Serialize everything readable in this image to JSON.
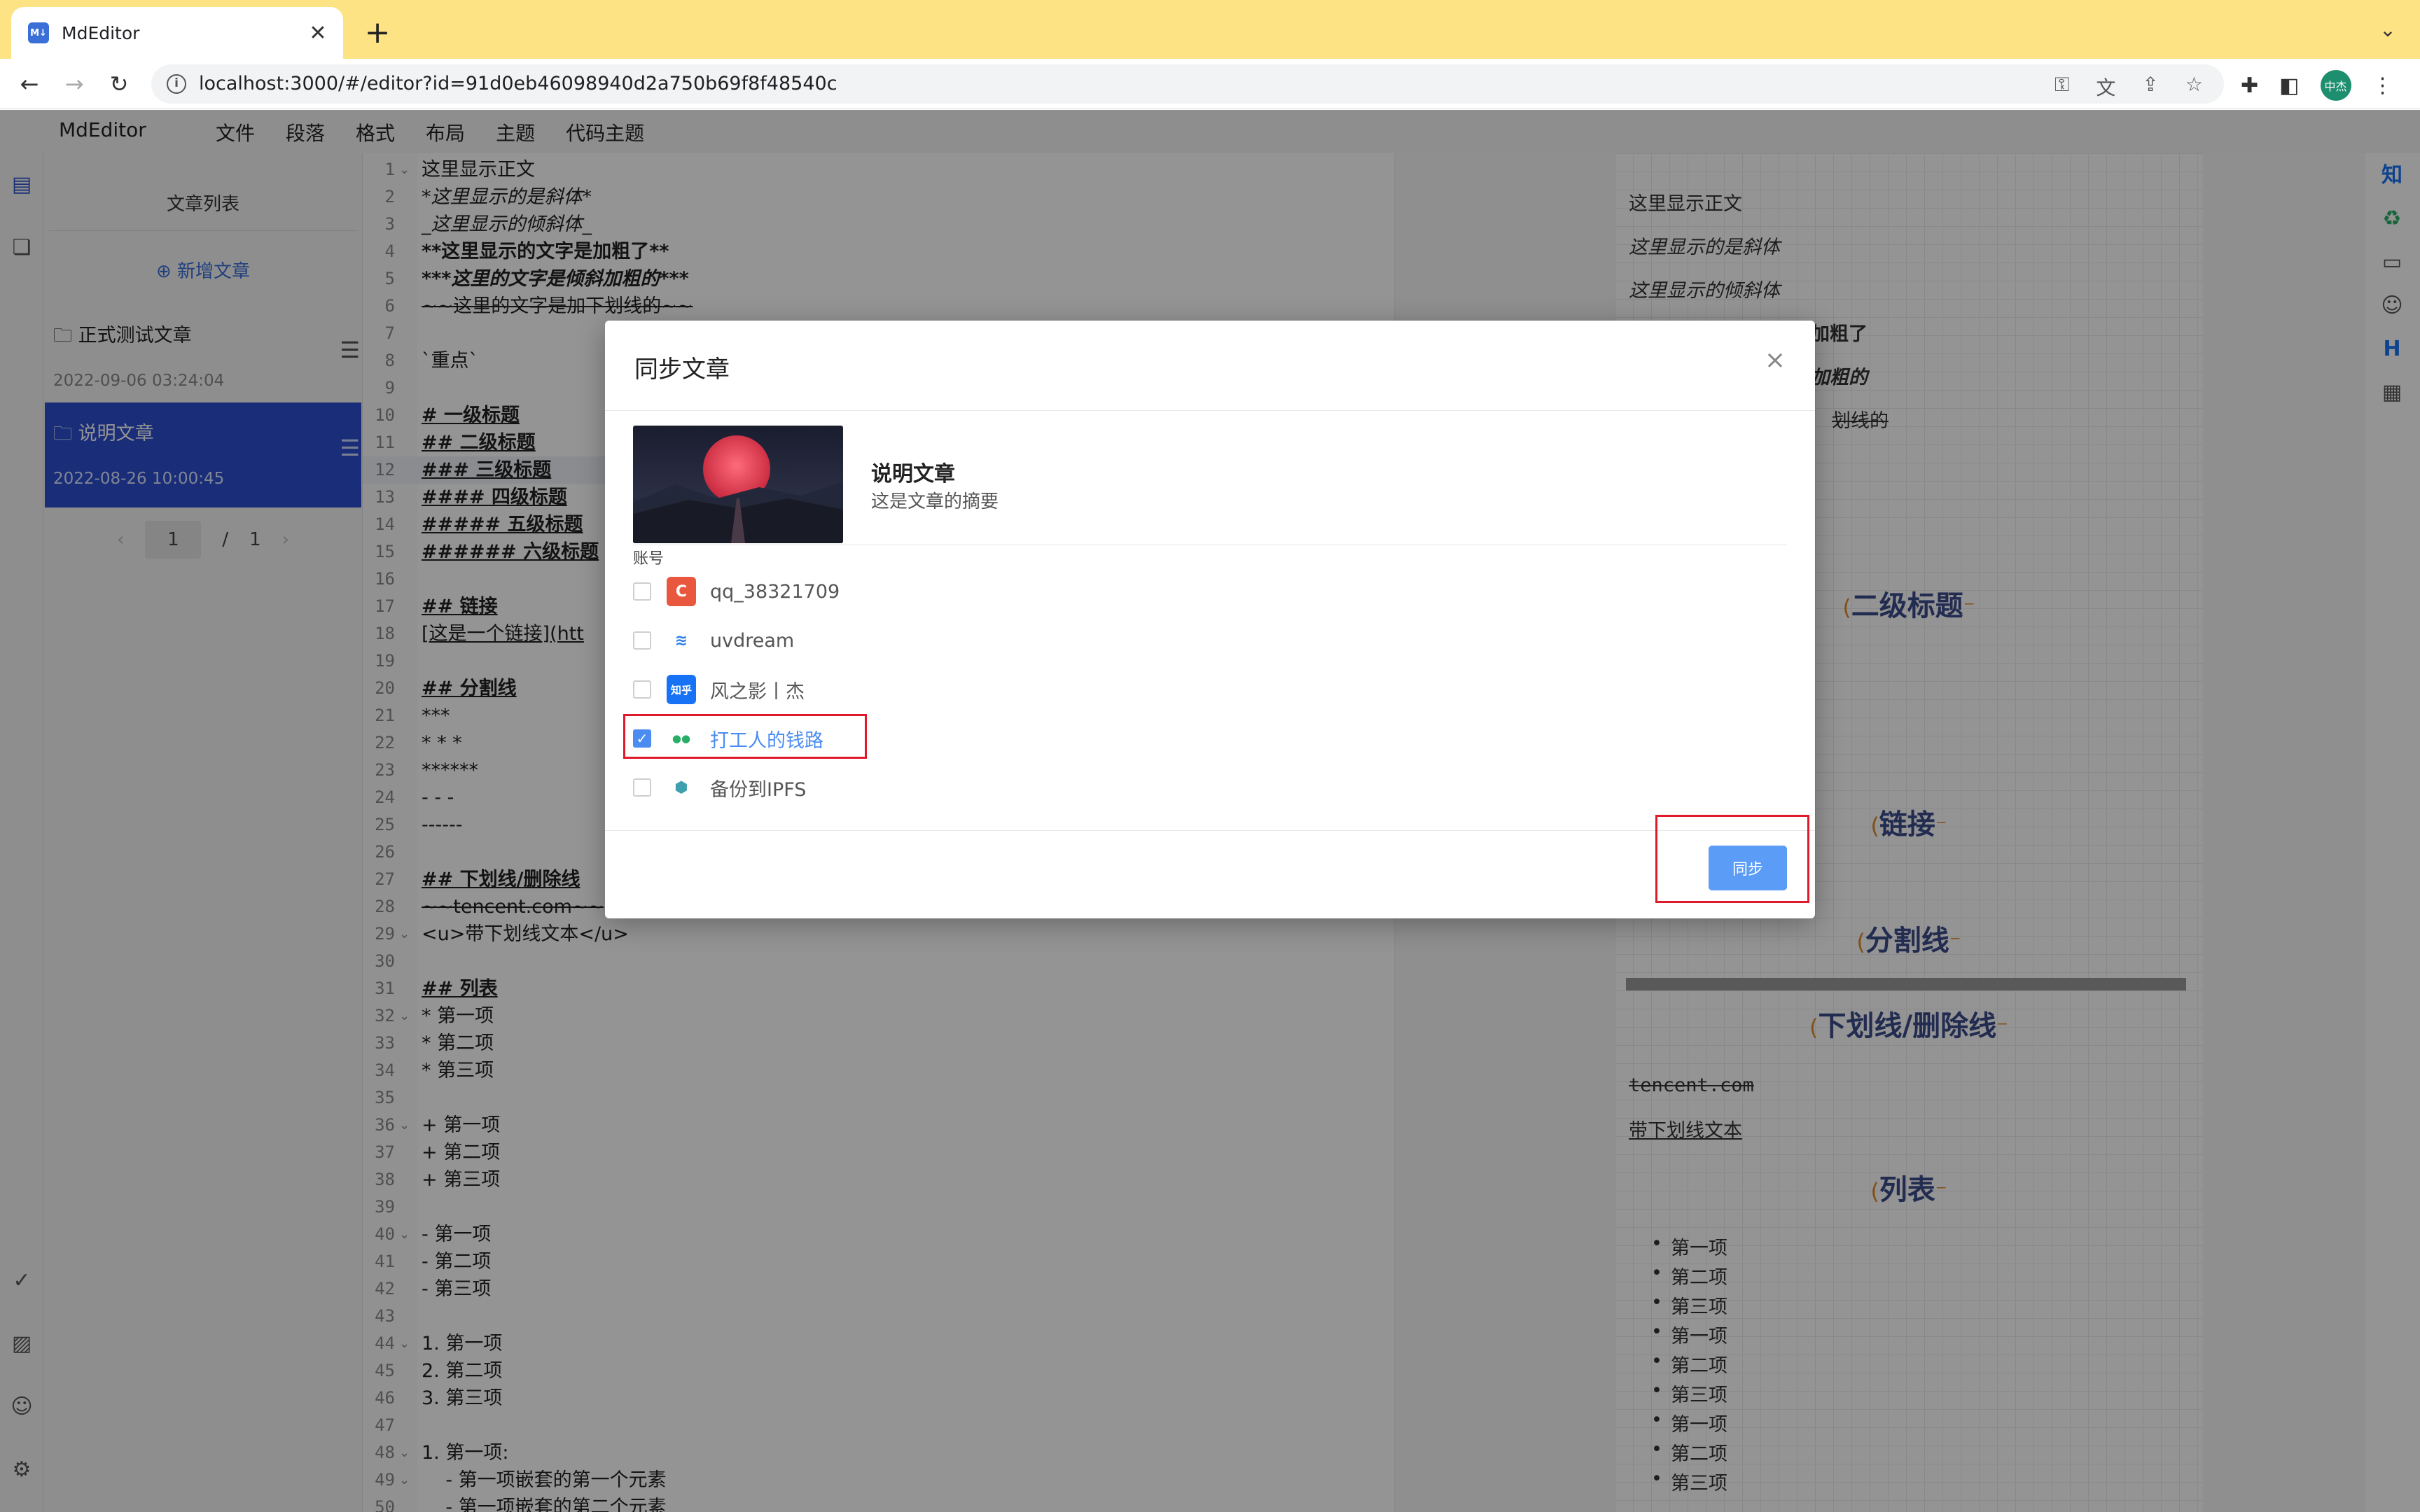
{
  "browser": {
    "tab_title": "MdEditor",
    "favicon_text": "M↓",
    "tab_close": "✕",
    "new_tab": "+",
    "tab_list": "⌄",
    "url": "localhost:3000/#/editor?id=91d0eb46098940d2a750b69f8f48540c",
    "profile_text": "中杰",
    "nav_icons": [
      "arrow-left-icon",
      "arrow-right-icon",
      "reload-icon"
    ],
    "omnibox_icons": [
      "key-icon",
      "translate-icon",
      "share-icon",
      "star-icon"
    ],
    "extension_icons": [
      "puzzle-icon",
      "sidepanel-icon"
    ]
  },
  "app": {
    "logo": "MdEditor",
    "menu": [
      "文件",
      "段落",
      "格式",
      "布局",
      "主题",
      "代码主题"
    ]
  },
  "list_panel": {
    "title": "文章列表",
    "new_article": "⊕ 新增文章",
    "articles": [
      {
        "title": "正式测试文章",
        "date": "2022-09-06 03:24:04",
        "active": false
      },
      {
        "title": "说明文章",
        "date": "2022-08-26 10:00:45",
        "active": true
      }
    ],
    "pager": {
      "current": "1",
      "separator": "/",
      "total": "1"
    }
  },
  "editor": {
    "lines": [
      {
        "n": "1",
        "fold": true,
        "text": "这里显示正文"
      },
      {
        "n": "2",
        "text": "*这里显示的是斜体*"
      },
      {
        "n": "3",
        "text": "_这里显示的倾斜体_"
      },
      {
        "n": "4",
        "text": "**这里显示的文字是加粗了**"
      },
      {
        "n": "5",
        "text": "***这里的文字是倾斜加粗的***"
      },
      {
        "n": "6",
        "text": "~~这里的文字是加下划线的~~"
      },
      {
        "n": "7",
        "text": ""
      },
      {
        "n": "8",
        "text": "`重点`"
      },
      {
        "n": "9",
        "text": ""
      },
      {
        "n": "10",
        "text": "# 一级标题"
      },
      {
        "n": "11",
        "text": "## 二级标题"
      },
      {
        "n": "12",
        "text": "### 三级标题",
        "active": true
      },
      {
        "n": "13",
        "text": "#### 四级标题"
      },
      {
        "n": "14",
        "text": "##### 五级标题"
      },
      {
        "n": "15",
        "text": "###### 六级标题"
      },
      {
        "n": "16",
        "text": ""
      },
      {
        "n": "17",
        "text": "## 链接"
      },
      {
        "n": "18",
        "text": "[这是一个链接](htt"
      },
      {
        "n": "19",
        "text": ""
      },
      {
        "n": "20",
        "text": "## 分割线"
      },
      {
        "n": "21",
        "text": "***"
      },
      {
        "n": "22",
        "text": "* * *"
      },
      {
        "n": "23",
        "text": "******"
      },
      {
        "n": "24",
        "text": "- - -"
      },
      {
        "n": "25",
        "text": "------"
      },
      {
        "n": "26",
        "text": ""
      },
      {
        "n": "27",
        "text": "## 下划线/删除线"
      },
      {
        "n": "28",
        "text": "~~tencent.com~~"
      },
      {
        "n": "29",
        "fold": true,
        "text": "<u>带下划线文本</u>"
      },
      {
        "n": "30",
        "text": ""
      },
      {
        "n": "31",
        "text": "## 列表"
      },
      {
        "n": "32",
        "fold": true,
        "text": "* 第一项"
      },
      {
        "n": "33",
        "text": "* 第二项"
      },
      {
        "n": "34",
        "text": "* 第三项"
      },
      {
        "n": "35",
        "text": ""
      },
      {
        "n": "36",
        "fold": true,
        "text": "+ 第一项"
      },
      {
        "n": "37",
        "text": "+ 第二项"
      },
      {
        "n": "38",
        "text": "+ 第三项"
      },
      {
        "n": "39",
        "text": ""
      },
      {
        "n": "40",
        "fold": true,
        "text": "- 第一项"
      },
      {
        "n": "41",
        "text": "- 第二项"
      },
      {
        "n": "42",
        "text": "- 第三项"
      },
      {
        "n": "43",
        "text": ""
      },
      {
        "n": "44",
        "fold": true,
        "text": "1. 第一项"
      },
      {
        "n": "45",
        "text": "2. 第二项"
      },
      {
        "n": "46",
        "text": "3. 第三项"
      },
      {
        "n": "47",
        "text": ""
      },
      {
        "n": "48",
        "fold": true,
        "text": "1. 第一项:"
      },
      {
        "n": "49",
        "fold": true,
        "text": "    - 第一项嵌套的第一个元素"
      },
      {
        "n": "50",
        "text": "    - 第一项嵌套的第二个元素"
      }
    ]
  },
  "preview": {
    "texts": [
      "这里显示正文",
      "这里显示的是斜体",
      "这里显示的倾斜体",
      "加粗了",
      "加粗的",
      "划线的"
    ],
    "headings": [
      "二级标题",
      "链接",
      "分割线",
      "下划线/删除线",
      "列表"
    ],
    "struck": "tencent.com",
    "underlined": "带下划线文本",
    "list_items": [
      "第一项",
      "第二项",
      "第三项",
      "第一项",
      "第二项",
      "第三项",
      "第一项",
      "第二项",
      "第三项"
    ]
  },
  "right_rail": {
    "icons": [
      "知",
      "♻",
      "▭",
      "☺",
      "H",
      "▦"
    ]
  },
  "modal": {
    "title": "同步文章",
    "close": "×",
    "article_title": "说明文章",
    "article_summary": "这是文章的摘要",
    "account_label": "账号",
    "accounts": [
      {
        "name": "qq_38321709",
        "icon_text": "C",
        "icon_bg": "#e9573f",
        "icon_color": "#ffffff",
        "checked": false
      },
      {
        "name": "uvdream",
        "icon_text": "≋",
        "icon_bg": "#ffffff",
        "icon_color": "#2e7fe8",
        "checked": false
      },
      {
        "name": "风之影丨杰",
        "icon_text": "知乎",
        "icon_bg": "#1772f6",
        "icon_color": "#ffffff",
        "checked": false
      },
      {
        "name": "打工人的钱路",
        "icon_text": "●●",
        "icon_bg": "#ffffff",
        "icon_color": "#2aae67",
        "checked": true
      },
      {
        "name": "备份到IPFS",
        "icon_text": "⬢",
        "icon_bg": "#ffffff",
        "icon_color": "#3ea0ae",
        "checked": false
      }
    ],
    "sync_button": "同步",
    "check_mark": "✓"
  },
  "colors": {
    "accent": "#2c4fcf",
    "button": "#5b9cf6",
    "highlight": "#e01a2b",
    "chrome": "#fde383"
  }
}
